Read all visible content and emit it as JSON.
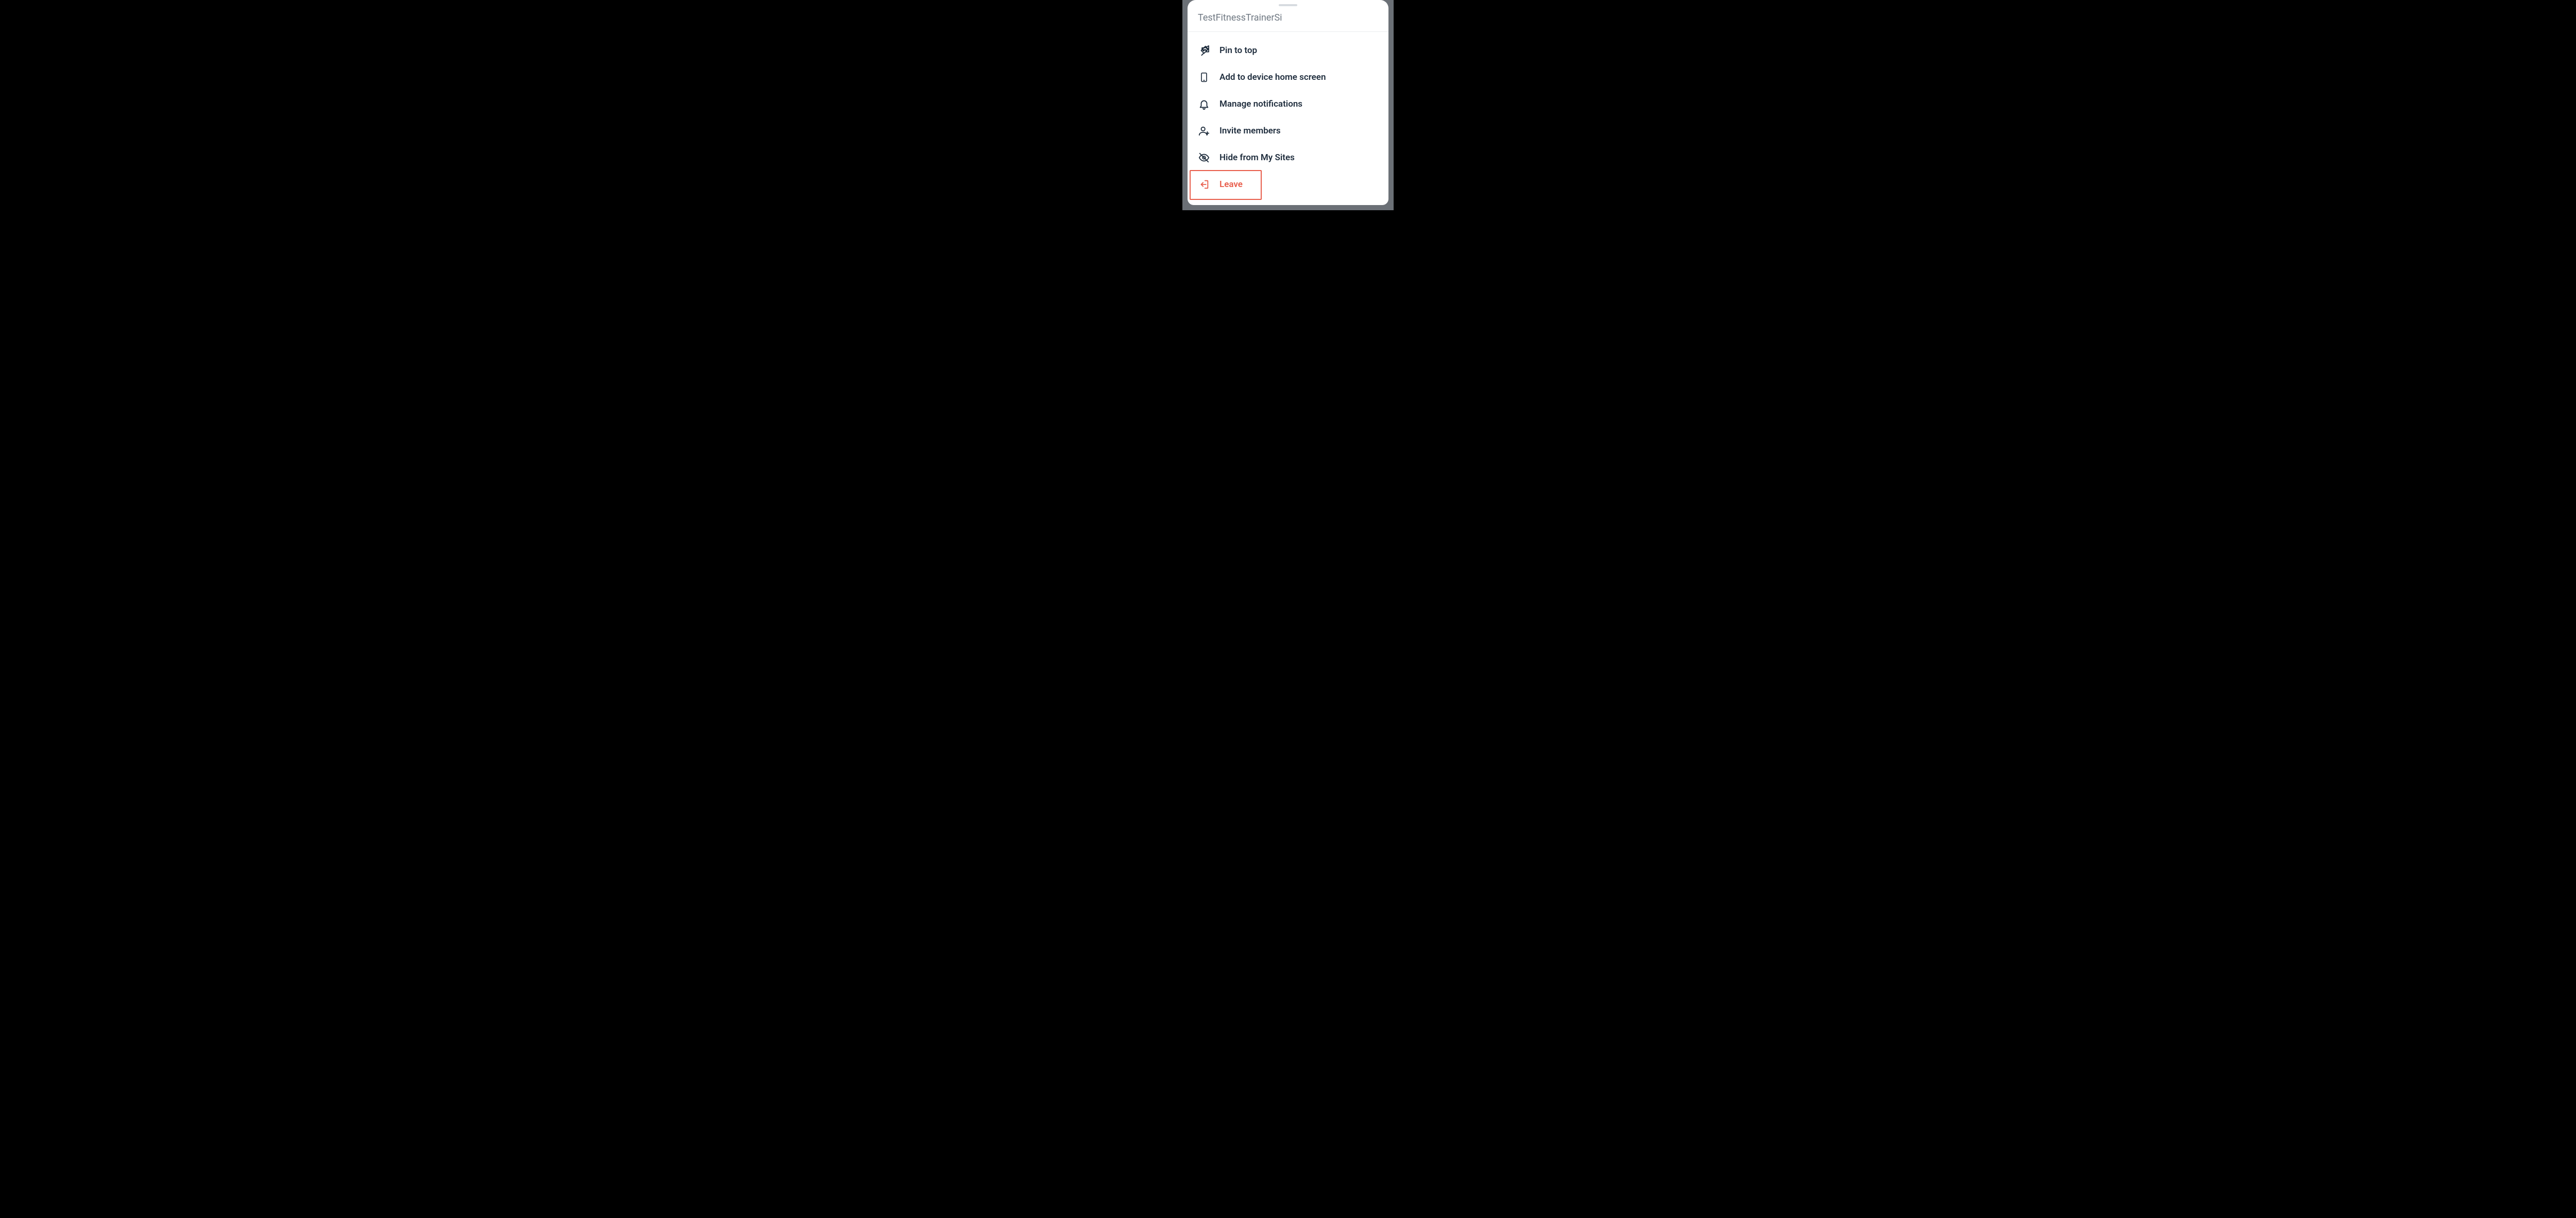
{
  "sheet": {
    "title": "TestFitnessTrainerSi",
    "items": [
      {
        "icon": "pin-icon",
        "label": "Pin to top",
        "danger": false
      },
      {
        "icon": "device-icon",
        "label": "Add to device home screen",
        "danger": false
      },
      {
        "icon": "bell-icon",
        "label": "Manage notifications",
        "danger": false
      },
      {
        "icon": "invite-icon",
        "label": "Invite members",
        "danger": false
      },
      {
        "icon": "eye-off-icon",
        "label": "Hide from My Sites",
        "danger": false
      },
      {
        "icon": "leave-icon",
        "label": "Leave",
        "danger": true
      }
    ]
  },
  "colors": {
    "danger": "#e85c4a",
    "text": "#1f2d3d",
    "muted": "#6f7882"
  }
}
